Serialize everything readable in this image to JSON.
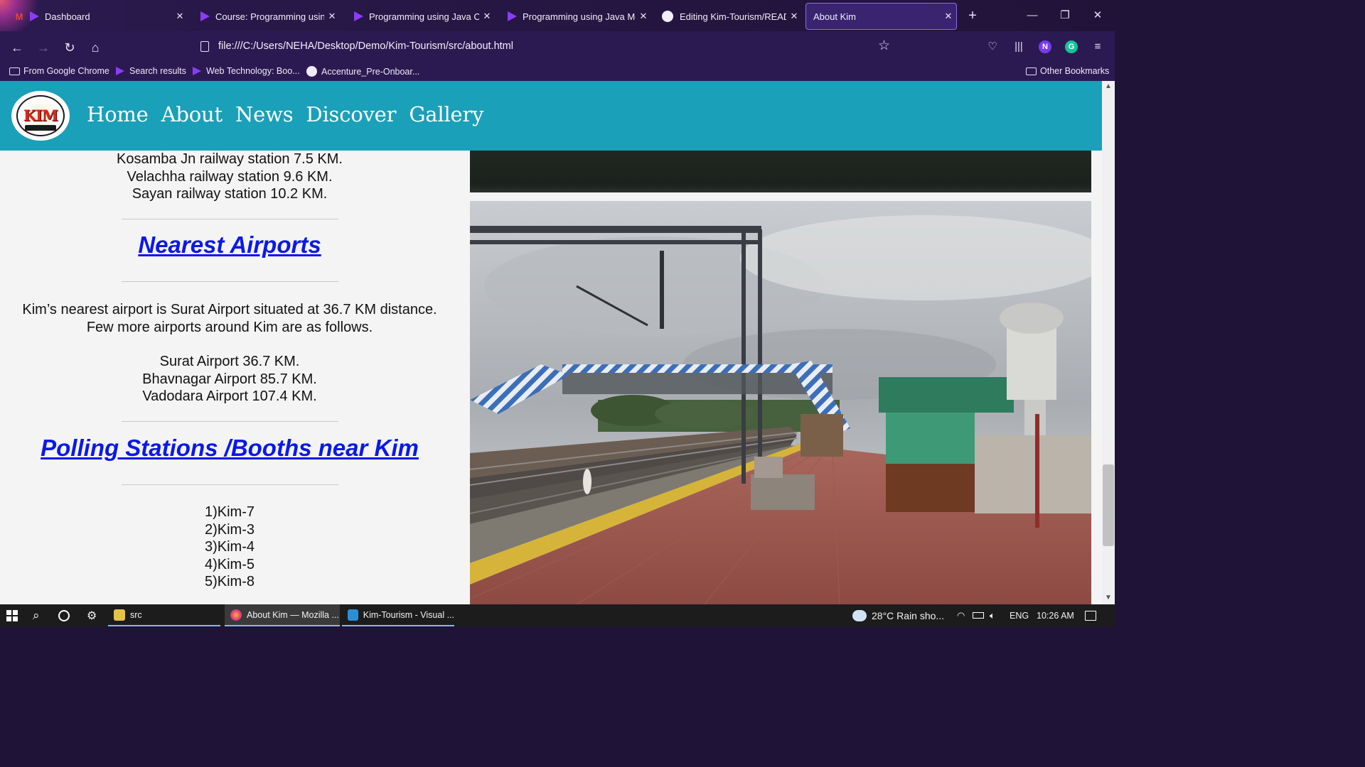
{
  "browser": {
    "tabs": [
      {
        "title": "Dashboard",
        "icon": "gmail-icon"
      },
      {
        "title": "Course: Programming using J",
        "icon": "play-icon"
      },
      {
        "title": "Programming using Java Cor",
        "icon": "play-icon"
      },
      {
        "title": "Programming using Java Mo",
        "icon": "play-icon"
      },
      {
        "title": "Editing Kim-Tourism/READM",
        "icon": "github-icon"
      },
      {
        "title": "About Kim",
        "icon": "page-icon",
        "active": true
      }
    ],
    "url": "file:///C:/Users/NEHA/Desktop/Demo/Kim-Tourism/src/about.html",
    "bookmarks": [
      {
        "label": "From Google Chrome",
        "icon": "folder-icon"
      },
      {
        "label": "Search results",
        "icon": "play-icon"
      },
      {
        "label": "Web Technology: Boo...",
        "icon": "play-icon"
      },
      {
        "label": "Accenture_Pre-Onboar...",
        "icon": "github-icon"
      }
    ],
    "other_bookmarks": "Other Bookmarks",
    "profile_initial": "N",
    "grammarly_initial": "G"
  },
  "site": {
    "logo_text": "KIM",
    "nav": [
      "Home",
      "About",
      "News",
      "Discover",
      "Gallery"
    ],
    "railway_tail": [
      "Kosamba Jn railway station 7.5 KM.",
      "Velachha railway station 9.6 KM.",
      "Sayan railway station 10.2 KM."
    ],
    "airports_heading": "Nearest Airports",
    "airports_intro": [
      "Kim’s nearest airport is Surat Airport situated at 36.7 KM distance.",
      "Few more airports around Kim are as follows."
    ],
    "airports_list": [
      "Surat Airport 36.7 KM.",
      "Bhavnagar Airport 85.7 KM.",
      "Vadodara Airport 107.4 KM."
    ],
    "polling_heading": "Polling Stations /Booths near Kim",
    "polling_list": [
      "1)Kim-7",
      "2)Kim-3",
      "3)Kim-4",
      "4)Kim-5",
      "5)Kim-8"
    ]
  },
  "taskbar": {
    "apps": [
      {
        "label": "src"
      },
      {
        "label": "About Kim — Mozilla ..."
      },
      {
        "label": "Kim-Tourism - Visual ..."
      }
    ],
    "weather": "28°C  Rain sho...",
    "language": "ENG",
    "time": "10:26 AM"
  }
}
